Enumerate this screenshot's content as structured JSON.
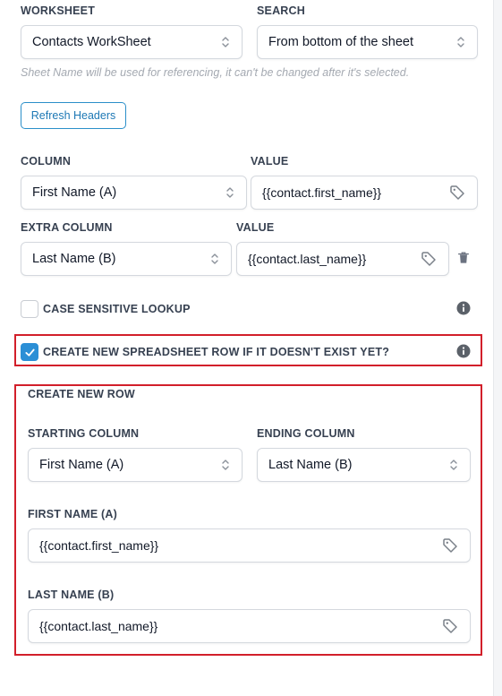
{
  "worksheet": {
    "label": "WORKSHEET",
    "value": "Contacts WorkSheet"
  },
  "search": {
    "label": "SEARCH",
    "value": "From bottom of the sheet"
  },
  "hint": "Sheet Name will be used for referencing, it can't be changed after it's selected.",
  "refresh_button": "Refresh Headers",
  "column": {
    "label": "COLUMN",
    "value": "First Name (A)"
  },
  "column_value": {
    "label": "VALUE",
    "value": "{{contact.first_name}}"
  },
  "extra_column": {
    "label": "EXTRA COLUMN",
    "value": "Last Name (B)"
  },
  "extra_value": {
    "label": "VALUE",
    "value": "{{contact.last_name}}"
  },
  "case_sensitive": {
    "label": "CASE SENSITIVE LOOKUP",
    "checked": false
  },
  "create_row_toggle": {
    "label": "CREATE NEW SPREADSHEET ROW IF IT DOESN'T EXIST YET?",
    "checked": true
  },
  "create_new_row": {
    "heading": "CREATE NEW ROW",
    "starting_column": {
      "label": "STARTING COLUMN",
      "value": "First Name (A)"
    },
    "ending_column": {
      "label": "ENDING COLUMN",
      "value": "Last Name (B)"
    },
    "first_name": {
      "label": "FIRST NAME (A)",
      "value": "{{contact.first_name}}"
    },
    "last_name": {
      "label": "LAST NAME (B)",
      "value": "{{contact.last_name}}"
    }
  },
  "colors": {
    "accent": "#2b8fd6",
    "highlight_border": "#d21f2a",
    "button_border": "#2b8fc9"
  },
  "icons": {
    "select": "chevron-up-down-icon",
    "tag": "tag-icon",
    "delete": "trash-icon",
    "info": "info-icon",
    "check": "check-icon"
  }
}
